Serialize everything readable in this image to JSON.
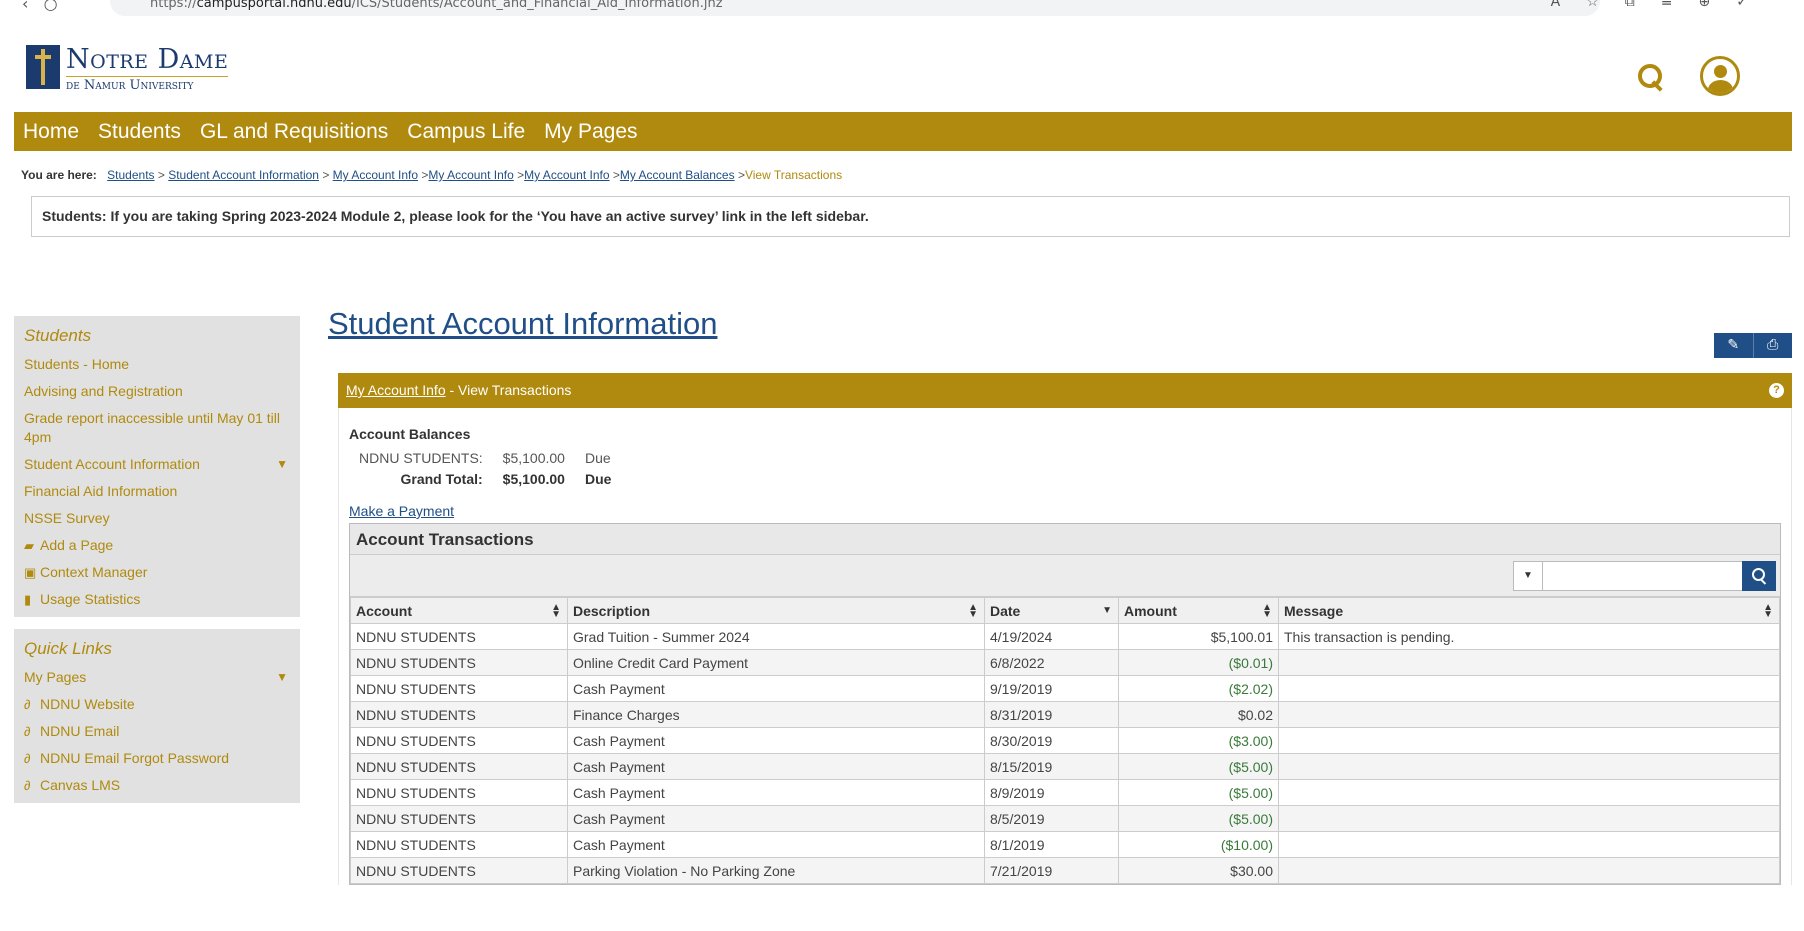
{
  "browser": {
    "url_prefix": "https://",
    "url_host": "campusportal.ndnu.edu",
    "url_path": "/ICS/Students/Account_and_Financial_Aid_Information.jnz"
  },
  "header": {
    "logo_line1": "Notre Dame",
    "logo_line2": "de Namur University"
  },
  "nav": [
    "Home",
    "Students",
    "GL and Requisitions",
    "Campus Life",
    "My Pages"
  ],
  "breadcrumb": {
    "label": "You are here:",
    "links": [
      "Students",
      "Student Account Information",
      "My Account Info",
      "My Account Info",
      "My Account Info",
      "My Account Balances"
    ],
    "current": "View Transactions"
  },
  "notice": "Students: If you are taking Spring 2023-2024 Module 2, please look for the ‘You have an active survey’ link in the left sidebar.",
  "sidebar": {
    "section1_title": "Students",
    "items": [
      "Students - Home",
      "Advising and Registration",
      "Grade report inaccessible until May 01 till 4pm",
      "Student Account Information",
      "Financial Aid Information",
      "NSSE Survey",
      "Add a Page",
      "Context Manager",
      "Usage Statistics"
    ],
    "section2_title": "Quick Links",
    "quick_links": [
      "My Pages",
      "NDNU Website",
      "NDNU Email",
      "NDNU Email Forgot Password",
      "Canvas LMS"
    ]
  },
  "page_title": "Student Account Information",
  "portlet": {
    "header_link": "My Account Info",
    "header_rest": " - View Transactions",
    "balances_title": "Account Balances",
    "balance_rows": [
      {
        "label": "NDNU STUDENTS:",
        "amount": "$5,100.00",
        "status": "Due"
      },
      {
        "label": "Grand Total:",
        "amount": "$5,100.00",
        "status": "Due"
      }
    ],
    "payment_link": "Make a Payment",
    "transactions_title": "Account Transactions",
    "columns": [
      "Account",
      "Description",
      "Date",
      "Amount",
      "Message"
    ],
    "rows": [
      {
        "account": "NDNU STUDENTS",
        "description": "Grad Tuition - Summer 2024",
        "date": "4/19/2024",
        "amount": "$5,100.01",
        "message": "This transaction is pending."
      },
      {
        "account": "NDNU STUDENTS",
        "description": "Online Credit Card Payment",
        "date": "6/8/2022",
        "amount": "($0.01)",
        "message": ""
      },
      {
        "account": "NDNU STUDENTS",
        "description": "Cash Payment",
        "date": "9/19/2019",
        "amount": "($2.02)",
        "message": ""
      },
      {
        "account": "NDNU STUDENTS",
        "description": "Finance Charges",
        "date": "8/31/2019",
        "amount": "$0.02",
        "message": ""
      },
      {
        "account": "NDNU STUDENTS",
        "description": "Cash Payment",
        "date": "8/30/2019",
        "amount": "($3.00)",
        "message": ""
      },
      {
        "account": "NDNU STUDENTS",
        "description": "Cash Payment",
        "date": "8/15/2019",
        "amount": "($5.00)",
        "message": ""
      },
      {
        "account": "NDNU STUDENTS",
        "description": "Cash Payment",
        "date": "8/9/2019",
        "amount": "($5.00)",
        "message": ""
      },
      {
        "account": "NDNU STUDENTS",
        "description": "Cash Payment",
        "date": "8/5/2019",
        "amount": "($5.00)",
        "message": ""
      },
      {
        "account": "NDNU STUDENTS",
        "description": "Cash Payment",
        "date": "8/1/2019",
        "amount": "($10.00)",
        "message": ""
      },
      {
        "account": "NDNU STUDENTS",
        "description": "Parking Violation - No Parking Zone",
        "date": "7/21/2019",
        "amount": "$30.00",
        "message": ""
      }
    ]
  },
  "colors": {
    "gold": "#b08a0e",
    "navy": "#1f4f86",
    "negative": "#3a7a3a"
  },
  "icons": [
    "search-icon",
    "user-icon",
    "wrench-icon",
    "print-icon",
    "help-icon",
    "chevron-down-icon",
    "link-icon"
  ]
}
